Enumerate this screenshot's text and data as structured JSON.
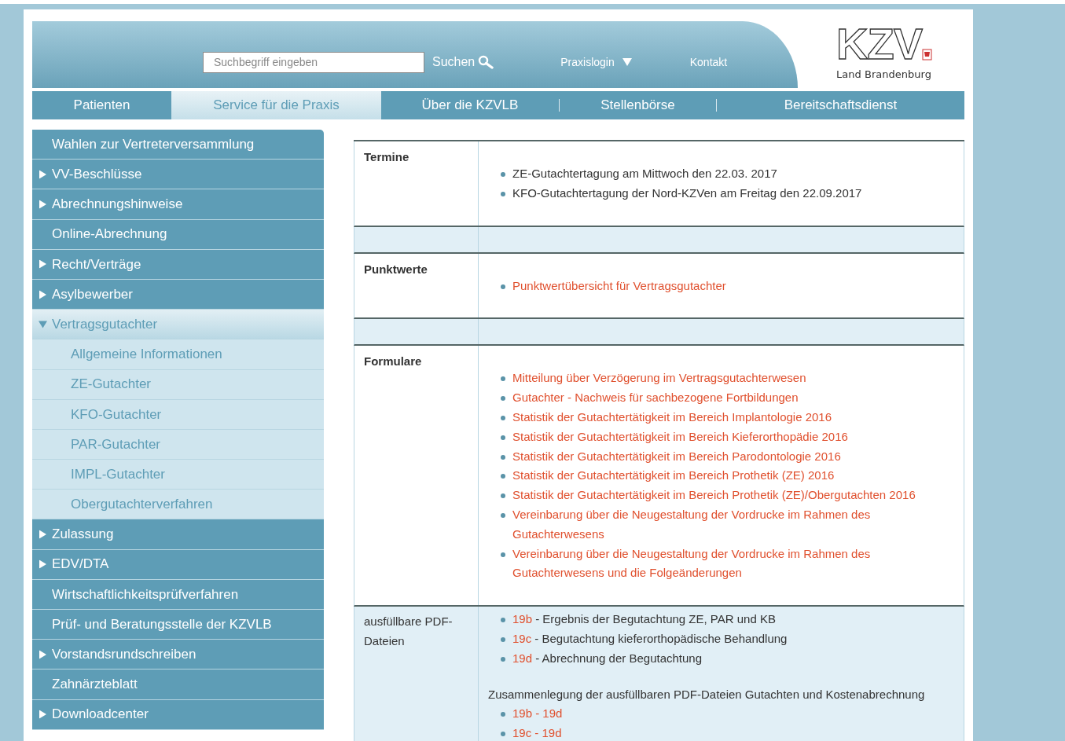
{
  "header": {
    "search": {
      "placeholder": "Suchbegriff eingeben",
      "button": "Suchen"
    },
    "links": [
      {
        "label": "Praxislogin",
        "dropdown": true
      },
      {
        "label": "Kontakt",
        "dropdown": false
      }
    ],
    "logo": {
      "name": "KZV",
      "subtitle": "Land Brandenburg"
    }
  },
  "nav": [
    {
      "label": "Patienten",
      "selected": false
    },
    {
      "label": "Service für die Praxis",
      "selected": true
    },
    {
      "label": "Über die KZVLB",
      "selected": false
    },
    {
      "label": "Stellenbörse",
      "selected": false
    },
    {
      "label": "Bereitschaftsdienst",
      "selected": false
    }
  ],
  "sidebar": {
    "items": [
      {
        "label": "Wahlen zur Vertreterversammlung",
        "selected": false
      },
      {
        "label": "VV-Beschlüsse",
        "expanded": false,
        "selected": false
      },
      {
        "label": "Abrechnungshinweise",
        "expanded": false,
        "selected": false
      },
      {
        "label": "Online-Abrechnung",
        "selected": false
      },
      {
        "label": "Recht/Verträge",
        "expanded": false,
        "selected": false
      },
      {
        "label": "Asylbewerber",
        "expanded": false,
        "selected": false
      },
      {
        "label": "Vertragsgutachter",
        "expanded": true,
        "selected": true,
        "children": [
          {
            "label": "Allgemeine Informationen"
          },
          {
            "label": "ZE-Gutachter"
          },
          {
            "label": "KFO-Gutachter"
          },
          {
            "label": "PAR-Gutachter"
          },
          {
            "label": "IMPL-Gutachter"
          },
          {
            "label": "Obergutachterverfahren"
          }
        ]
      },
      {
        "label": "Zulassung",
        "expanded": false,
        "selected": false
      },
      {
        "label": "EDV/DTA",
        "expanded": false,
        "selected": false
      },
      {
        "label": "Wirtschaftlichkeitsprüfverfahren",
        "selected": false
      },
      {
        "label": "Prüf- und Beratungsstelle der KZVLB",
        "selected": false
      },
      {
        "label": "Vorstandsrundschreiben",
        "expanded": false,
        "selected": false
      },
      {
        "label": "Zahnärzteblatt",
        "selected": false
      },
      {
        "label": "Downloadcenter",
        "expanded": false,
        "selected": false
      }
    ]
  },
  "table": {
    "rows": [
      {
        "kind": "section",
        "label": "Termine",
        "blocks": [
          {
            "kind": "list",
            "items": [
              {
                "text": "ZE-Gutachtertagung am Mittwoch den 22.03. 2017"
              },
              {
                "text": "KFO-Gutachtertagung der Nord-KZVen am Freitag den 22.09.2017"
              }
            ]
          }
        ]
      },
      {
        "kind": "spacer"
      },
      {
        "kind": "section",
        "label": "Punktwerte",
        "blocks": [
          {
            "kind": "list",
            "items": [
              {
                "link": "Punktwertübersicht für Vertragsgutachter"
              }
            ]
          }
        ]
      },
      {
        "kind": "spacer"
      },
      {
        "kind": "section",
        "label": "Formulare",
        "blocks": [
          {
            "kind": "list",
            "items": [
              {
                "link": "Mitteilung über Verzögerung im Vertragsgutachterwesen"
              },
              {
                "link": "Gutachter - Nachweis für sachbezogene Fortbildungen"
              },
              {
                "link": "Statistik der Gutachtertätigkeit im Bereich Implantologie 2016"
              },
              {
                "link": "Statistik der Gutachtertätigkeit im Bereich Kieferorthopädie 2016"
              },
              {
                "link": "Statistik der Gutachtertätigkeit im Bereich Parodontologie 2016"
              },
              {
                "link": "Statistik der Gutachtertätigkeit im Bereich Prothetik (ZE) 2016"
              },
              {
                "link": "Statistik der Gutachtertätigkeit im Bereich Prothetik (ZE)/Obergutachten 2016"
              },
              {
                "link": "Vereinbarung über die Neugestaltung der Vordrucke im Rahmen des Gutachterwesens"
              },
              {
                "link": "Vereinbarung über die Neugestaltung der Vordrucke im Rahmen des Gutachterwesens und die Folgeänderungen"
              }
            ]
          }
        ]
      },
      {
        "kind": "downloads",
        "label": "ausfüllbare PDF-Dateien",
        "blocks": [
          {
            "kind": "list",
            "items": [
              {
                "link": "19b",
                "text": "- Ergebnis der Begutachtung ZE, PAR und KB"
              },
              {
                "link": "19c",
                "text": "- Begutachtung kieferorthopädische Behandlung"
              },
              {
                "link": "19d",
                "text": "- Abrechnung der Begutachtung"
              }
            ]
          },
          {
            "kind": "paragraph",
            "text": "Zusammenlegung der ausfüllbaren PDF-Dateien Gutachten und Kostenabrechnung"
          },
          {
            "kind": "list",
            "items": [
              {
                "link": "19b - 19d"
              },
              {
                "link": "19c - 19d"
              }
            ]
          }
        ]
      }
    ]
  }
}
